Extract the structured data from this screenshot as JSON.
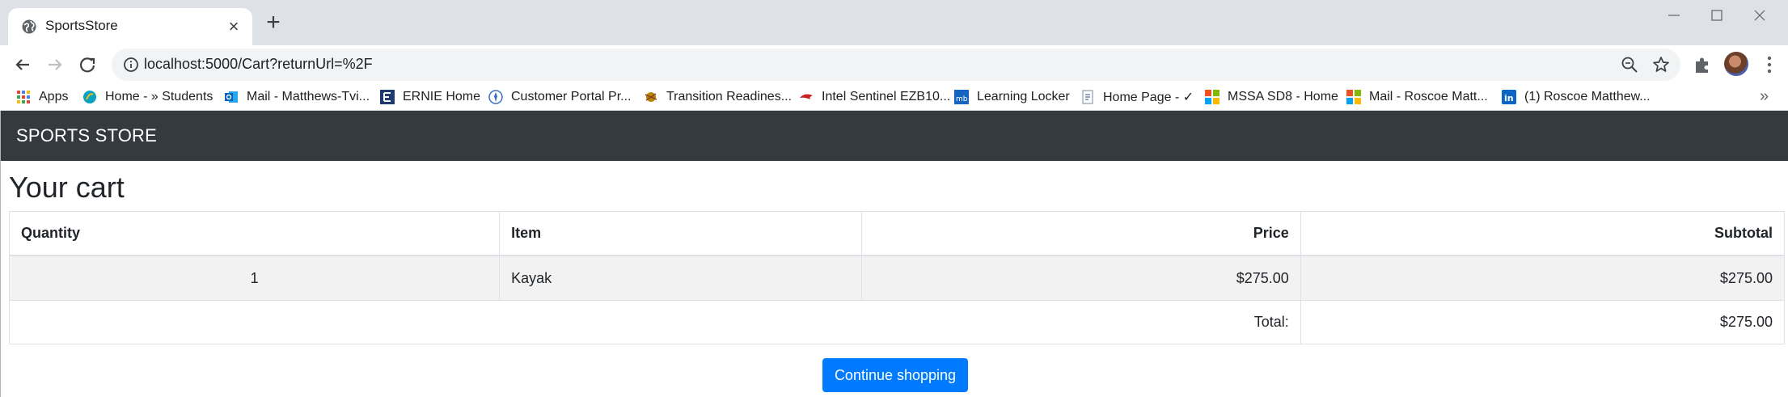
{
  "browser": {
    "tab": {
      "title": "SportsStore",
      "favicon": "globe-icon"
    },
    "address": {
      "url": "localhost:5000/Cart?returnUrl=%2F"
    },
    "bookmarks": [
      {
        "label": "Apps",
        "icon": "apps-grid-icon"
      },
      {
        "label": "Home - » Students",
        "icon": "site-icon"
      },
      {
        "label": "Mail - Matthews-Tvi...",
        "icon": "outlook-icon"
      },
      {
        "label": "ERNIE Home",
        "icon": "ernie-icon"
      },
      {
        "label": "Customer Portal Pr...",
        "icon": "portal-icon"
      },
      {
        "label": "Transition Readines...",
        "icon": "emblem-icon"
      },
      {
        "label": "Intel Sentinel EZB10...",
        "icon": "sentinel-icon"
      },
      {
        "label": "Learning Locker",
        "icon": "mb-icon"
      },
      {
        "label": "Home Page - ✓",
        "icon": "page-icon"
      },
      {
        "label": "MSSA SD8 - Home",
        "icon": "microsoft-icon"
      },
      {
        "label": "Mail - Roscoe Matt...",
        "icon": "microsoft-icon"
      },
      {
        "label": "(1) Roscoe Matthew...",
        "icon": "linkedin-icon"
      }
    ],
    "bookmarks_more": "»"
  },
  "navbar": {
    "brand": "SPORTS STORE"
  },
  "cart": {
    "heading": "Your cart",
    "columns": [
      "Quantity",
      "Item",
      "Price",
      "Subtotal"
    ],
    "rows": [
      {
        "quantity": "1",
        "item": "Kayak",
        "price": "$275.00",
        "subtotal": "$275.00"
      }
    ],
    "total_label": "Total:",
    "total_value": "$275.00",
    "continue_label": "Continue shopping"
  },
  "colors": {
    "navbar_bg": "#343a40",
    "primary_button": "#007bff",
    "tabstrip_bg": "#dee1e6"
  }
}
